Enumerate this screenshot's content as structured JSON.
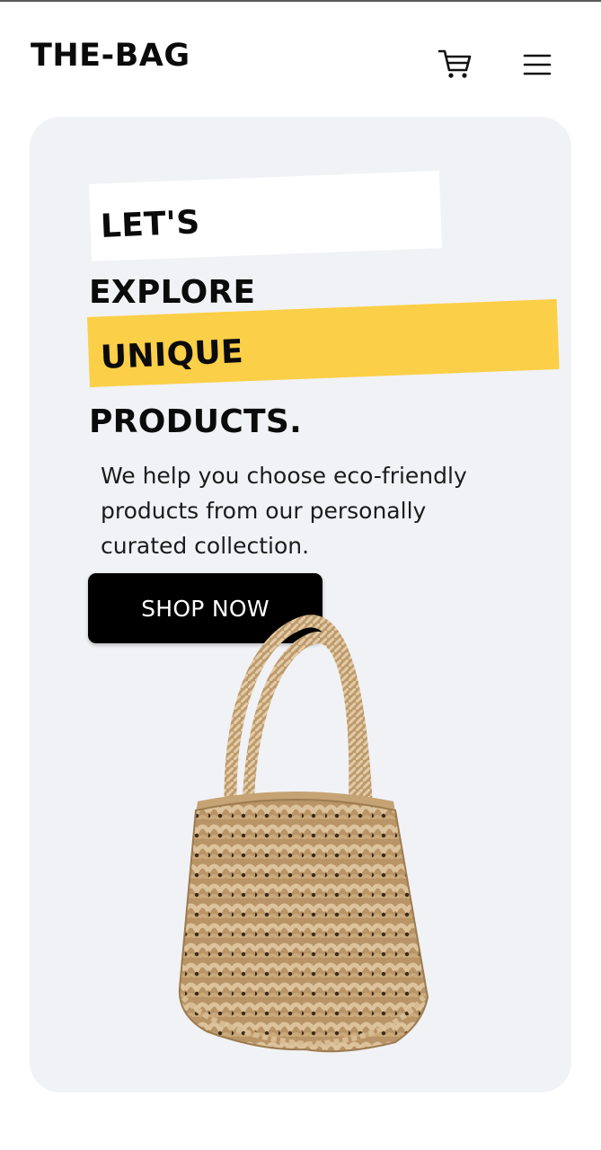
{
  "header": {
    "brand": "THE-BAG",
    "cart_icon": "cart-icon",
    "menu_icon": "hamburger-menu-icon"
  },
  "hero": {
    "headline": [
      "LET'S",
      "EXPLORE",
      "UNIQUE",
      "PRODUCTS."
    ],
    "description_lines": [
      "We help you choose eco-friendly",
      "products from our personally",
      "curated collection."
    ],
    "cta_label": "SHOP NOW",
    "product_image": "woven-macrame-bag"
  },
  "colors": {
    "accent_yellow": "#fbcf47",
    "hero_background": "#f1f2f5",
    "button_background": "#000000",
    "bag_tan": "#c9a77c"
  }
}
